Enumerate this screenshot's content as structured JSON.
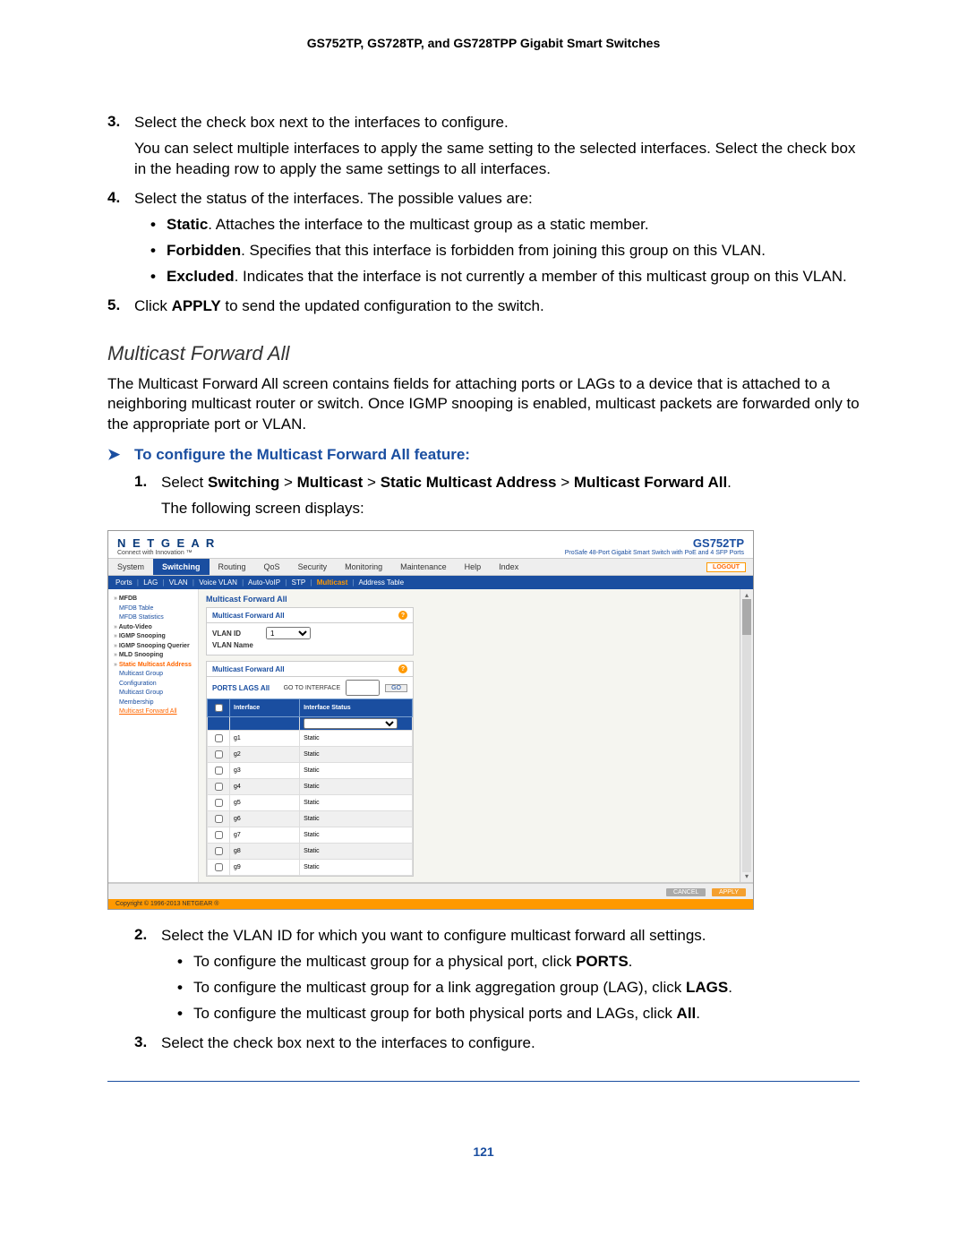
{
  "header_title": "GS752TP, GS728TP, and GS728TPP Gigabit Smart Switches",
  "steps_a": {
    "s3": {
      "num": "3.",
      "text": "Select the check box next to the interfaces to configure.",
      "para": "You can select multiple interfaces to apply the same setting to the selected interfaces. Select the check box in the heading row to apply the same settings to all interfaces."
    },
    "s4": {
      "num": "4.",
      "text": "Select the status of the interfaces. The possible values are:",
      "b1_strong": "Static",
      "b1_rest": ". Attaches the interface to the multicast group as a static member.",
      "b2_strong": "Forbidden",
      "b2_rest": ". Specifies that this interface is forbidden from joining this group on this VLAN.",
      "b3_strong": "Excluded",
      "b3_rest": ". Indicates that the interface is not currently a member of this multicast group on this VLAN."
    },
    "s5": {
      "num": "5.",
      "pre": "Click ",
      "bold": "APPLY",
      "post": " to send the updated configuration to the switch."
    }
  },
  "section_heading": "Multicast Forward All",
  "section_para": "The Multicast Forward All screen contains fields for attaching ports or LAGs to a device that is attached to a neighboring multicast router or switch. Once IGMP snooping is enabled, multicast packets are forwarded only to the appropriate port or VLAN.",
  "proc_heading": "To configure the Multicast Forward All feature:",
  "steps_b": {
    "s1": {
      "num": "1.",
      "pre": "Select ",
      "p1": "Switching",
      "sep": " > ",
      "p2": "Multicast",
      "p3": "Static Multicast Address",
      "p4": "Multicast Forward All",
      "post": ".",
      "para": "The following screen displays:"
    },
    "s2": {
      "num": "2.",
      "text": "Select the VLAN ID for which you want to configure multicast forward all settings.",
      "b1_pre": "To configure the multicast group for a physical port, click ",
      "b1_bold": "PORTS",
      "b1_post": ".",
      "b2_pre": "To configure the multicast group for a link aggregation group (LAG), click ",
      "b2_bold": "LAGS",
      "b2_post": ".",
      "b3_pre": "To configure the multicast group for both physical ports and LAGs, click ",
      "b3_bold": "All",
      "b3_post": "."
    },
    "s3": {
      "num": "3.",
      "text": "Select the check box next to the interfaces to configure."
    }
  },
  "screenshot": {
    "logo": "N E T G E A R",
    "tagline": "Connect with Innovation ™",
    "model": "GS752TP",
    "model_sub": "ProSafe 48-Port Gigabit Smart Switch with PoE and 4 SFP Ports",
    "logout": "LOGOUT",
    "tabs": [
      "System",
      "Switching",
      "Routing",
      "QoS",
      "Security",
      "Monitoring",
      "Maintenance",
      "Help",
      "Index"
    ],
    "tabs_active_index": 1,
    "subtabs": "Ports | LAG | VLAN | Voice VLAN | Auto-VoIP | STP | Multicast | Address Table",
    "subtabs_bold": "Multicast",
    "sidebar": [
      {
        "t": "MFDB",
        "cls": "top bullet-pre"
      },
      {
        "t": "MFDB Table",
        "cls": "sub"
      },
      {
        "t": "MFDB Statistics",
        "cls": "sub"
      },
      {
        "t": "Auto-Video",
        "cls": "top bullet-pre"
      },
      {
        "t": "IGMP Snooping",
        "cls": "top bullet-pre"
      },
      {
        "t": "IGMP Snooping Querier",
        "cls": "top bullet-pre"
      },
      {
        "t": "MLD Snooping",
        "cls": "top bullet-pre"
      },
      {
        "t": "Static Multicast Address",
        "cls": "top bullet-pre sel-top"
      },
      {
        "t": "Multicast Group Configuration",
        "cls": "sub"
      },
      {
        "t": "Multicast Group Membership",
        "cls": "sub"
      },
      {
        "t": "Multicast Forward All",
        "cls": "sub sel"
      }
    ],
    "main_title": "Multicast Forward All",
    "box1_head": "Multicast Forward All",
    "vlan_id_lbl": "VLAN ID",
    "vlan_id_val": "1",
    "vlan_name_lbl": "VLAN Name",
    "box2_head": "Multicast Forward All",
    "tabs2": "PORTS LAGS All",
    "go_lbl": "GO TO INTERFACE",
    "go_btn": "GO",
    "th1": "Interface",
    "th2": "Interface Status",
    "rows": [
      {
        "if": "g1",
        "st": "Static"
      },
      {
        "if": "g2",
        "st": "Static"
      },
      {
        "if": "g3",
        "st": "Static"
      },
      {
        "if": "g4",
        "st": "Static"
      },
      {
        "if": "g5",
        "st": "Static"
      },
      {
        "if": "g6",
        "st": "Static"
      },
      {
        "if": "g7",
        "st": "Static"
      },
      {
        "if": "g8",
        "st": "Static"
      },
      {
        "if": "g9",
        "st": "Static"
      }
    ],
    "cancel": "CANCEL",
    "apply": "APPLY",
    "copyright": "Copyright © 1996-2013 NETGEAR ®"
  },
  "page_number": "121"
}
